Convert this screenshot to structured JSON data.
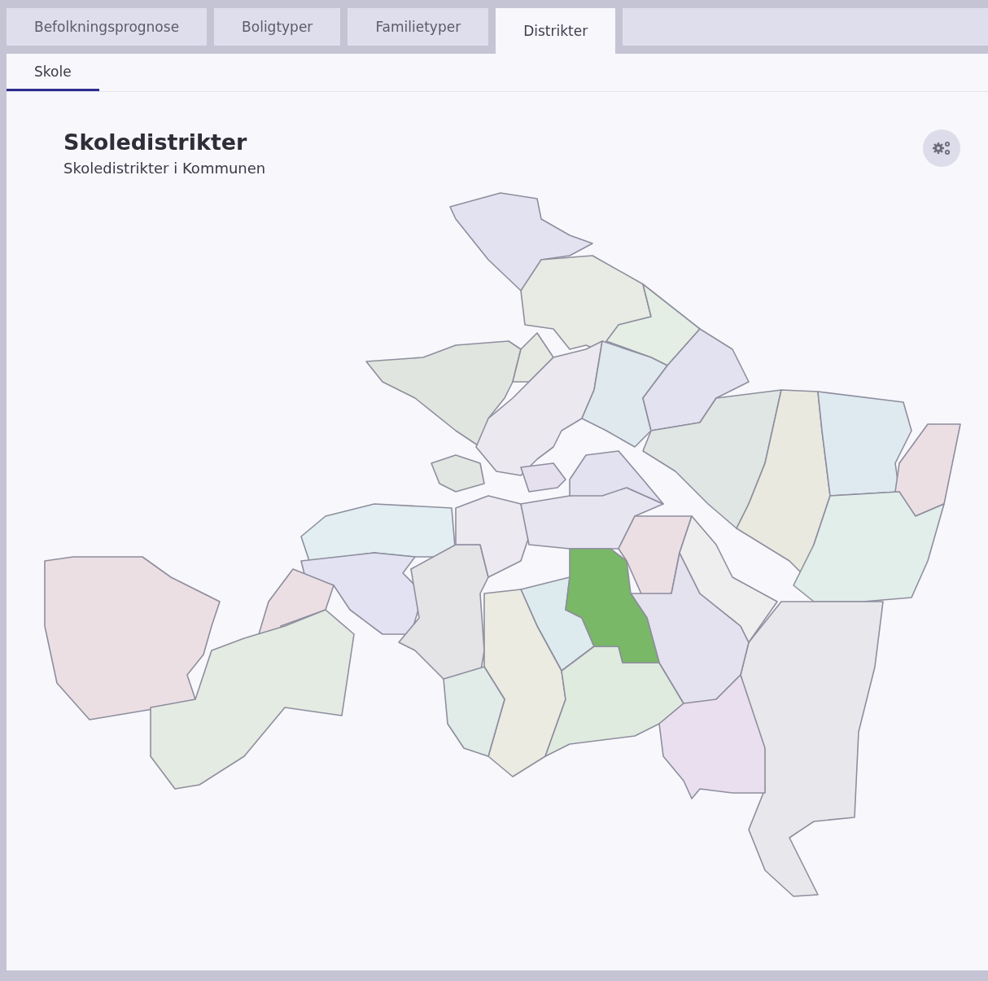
{
  "tabs": [
    {
      "label": "Befolkningsprognose",
      "selected": false
    },
    {
      "label": "Boligtyper",
      "selected": false
    },
    {
      "label": "Familietyper",
      "selected": false
    },
    {
      "label": "Distrikter",
      "selected": true
    }
  ],
  "subtabs": [
    {
      "label": "Skole",
      "selected": true
    }
  ],
  "panel": {
    "title": "Skoledistrikter",
    "subtitle": "Skoledistrikter i Kommunen"
  }
}
